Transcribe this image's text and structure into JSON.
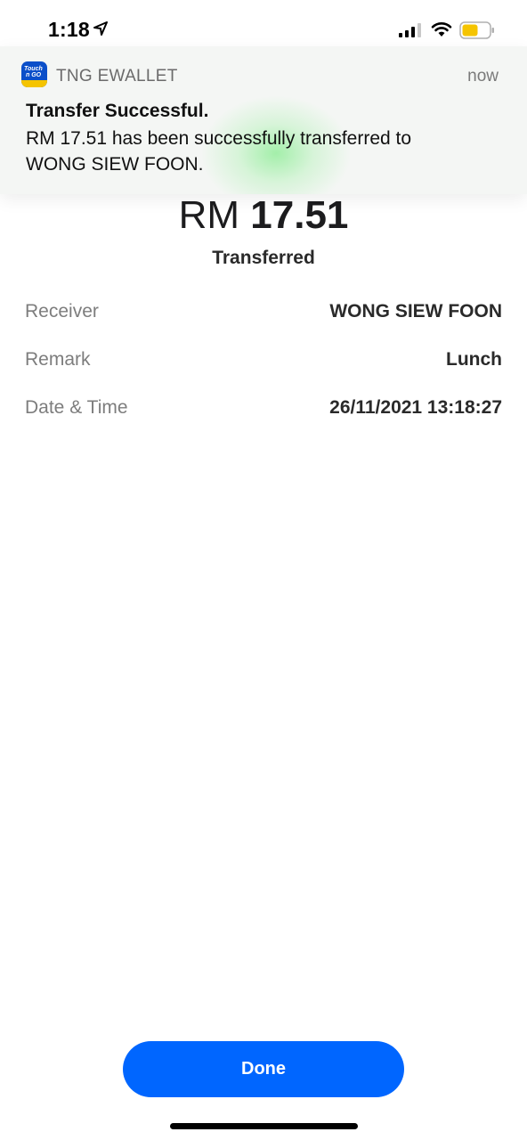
{
  "status_bar": {
    "time": "1:18",
    "icons": [
      "location-arrow-icon",
      "cellular-signal-icon",
      "wifi-icon",
      "battery-icon"
    ],
    "battery_color": "#f5c400"
  },
  "notification": {
    "app_name": "TNG EWALLET",
    "time": "now",
    "title": "Transfer Successful.",
    "body_line1": "RM 17.51 has been successfully transferred to",
    "body_line2": "WONG SIEW FOON.",
    "app_icon_text_1": "Touch",
    "app_icon_text_2": "n GO"
  },
  "transaction": {
    "currency": "RM",
    "amount": "17.51",
    "status": "Transferred",
    "details": [
      {
        "label": "Receiver",
        "value": "WONG SIEW FOON"
      },
      {
        "label": "Remark",
        "value": "Lunch"
      },
      {
        "label": "Date & Time",
        "value": "26/11/2021 13:18:27"
      }
    ]
  },
  "actions": {
    "done_label": "Done",
    "accent_color": "#0066ff"
  }
}
